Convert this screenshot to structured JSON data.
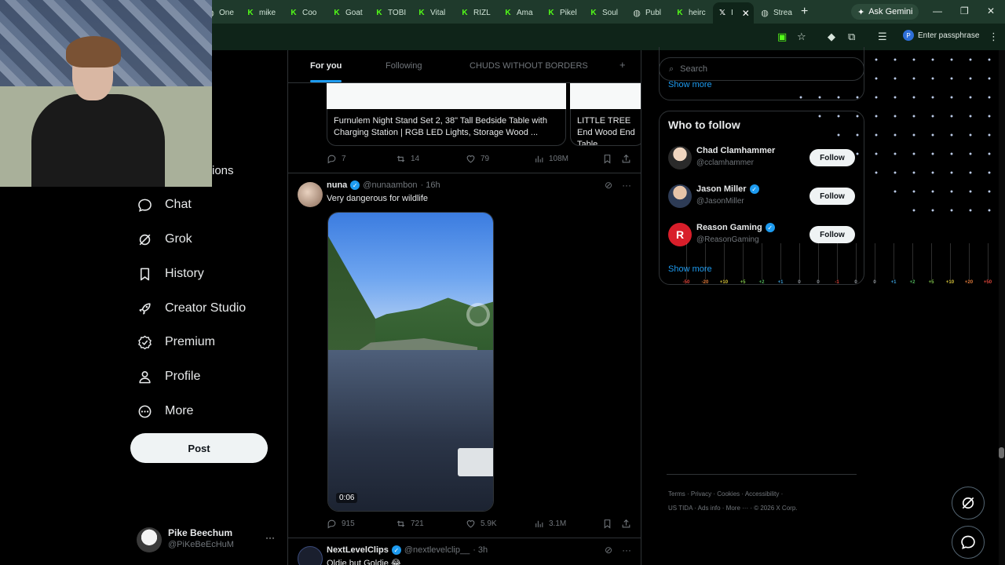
{
  "browser": {
    "tabs": [
      {
        "label": "One",
        "icon": "globe-icon",
        "active": false
      },
      {
        "label": "mike",
        "icon": "kick-icon",
        "active": false
      },
      {
        "label": "Coo",
        "icon": "kick-icon",
        "active": false
      },
      {
        "label": "Goat",
        "icon": "kick-icon",
        "active": false
      },
      {
        "label": "TOBI",
        "icon": "kick-icon",
        "active": false
      },
      {
        "label": "Vital",
        "icon": "kick-icon",
        "active": false
      },
      {
        "label": "RIZL",
        "icon": "kick-icon",
        "active": false
      },
      {
        "label": "Ama",
        "icon": "kick-icon",
        "active": false
      },
      {
        "label": "Pikel",
        "icon": "kick-icon",
        "active": false
      },
      {
        "label": "Soul",
        "icon": "kick-icon",
        "active": false
      },
      {
        "label": "Publ",
        "icon": "globe-icon",
        "active": false
      },
      {
        "label": "heirc",
        "icon": "kick-icon",
        "active": false
      },
      {
        "label": "I",
        "icon": "x-icon",
        "active": true
      },
      {
        "label": "Strea",
        "icon": "globe-icon",
        "active": false
      }
    ],
    "gemini_label": "Ask Gemini",
    "passphrase_label": "Enter passphrase",
    "passphrase_avatar": "P"
  },
  "nav": {
    "partial_label": "ions",
    "items": [
      {
        "label": "Chat",
        "icon": "chat-icon"
      },
      {
        "label": "Grok",
        "icon": "grok-icon"
      },
      {
        "label": "History",
        "icon": "bookmark-icon"
      },
      {
        "label": "Creator Studio",
        "icon": "rocket-icon"
      },
      {
        "label": "Premium",
        "icon": "verified-icon"
      },
      {
        "label": "Profile",
        "icon": "person-icon"
      },
      {
        "label": "More",
        "icon": "more-circle-icon"
      }
    ],
    "post_label": "Post",
    "account": {
      "name": "Pike Beechum",
      "handle": "@PiKeBeEcHuM",
      "more": "···"
    }
  },
  "feed": {
    "tabs": [
      "For you",
      "Following",
      "CHUDS WITHOUT BORDERS",
      "+"
    ],
    "cards": [
      {
        "caption": "Furnulem Night Stand Set 2, 38\" Tall Bedside Table with Charging Station | RGB LED Lights, Storage Wood ..."
      },
      {
        "caption": "LITTLE TREE End Wood End Table"
      }
    ],
    "card_actions": {
      "replies": "7",
      "reposts": "14",
      "likes": "79",
      "views": "108M"
    },
    "posts": [
      {
        "name": "nuna",
        "handle": "@nunaambon",
        "time": "· 16h",
        "text": "Very dangerous for wildlife",
        "video_duration": "0:06",
        "replies": "915",
        "reposts": "721",
        "likes": "5.9K",
        "views": "3.1M"
      },
      {
        "name": "NextLevelClips",
        "handle": "@nextlevelclip__",
        "time": "· 3h",
        "text": "Oldie but Goldie 😂"
      }
    ]
  },
  "sidebar": {
    "search_placeholder": "Search",
    "trends_show_more": "Show more",
    "who_to_follow": {
      "title": "Who to follow",
      "users": [
        {
          "name": "Chad Clamhammer",
          "handle": "@cclamhammer",
          "verified": false,
          "button": "Follow"
        },
        {
          "name": "Jason Miller",
          "handle": "@JasonMiller",
          "verified": true,
          "button": "Follow"
        },
        {
          "name": "Reason Gaming",
          "handle": "@ReasonGaming",
          "verified": true,
          "button": "Follow"
        }
      ],
      "show_more": "Show more"
    },
    "meter_labels": [
      "-50",
      "-20",
      "+10",
      "+5",
      "+2",
      "+1",
      "0",
      "0",
      "-1",
      "0",
      "0",
      "+1",
      "+2",
      "+5",
      "+10",
      "+20",
      "+50"
    ],
    "meter_colors": [
      "#e0453a",
      "#e07a3a",
      "#d9c53a",
      "#7fc24a",
      "#4fb35a",
      "#3a9ed9",
      "#9aa0a6",
      "#9aa0a6",
      "#e0453a",
      "#9aa0a6",
      "#9aa0a6",
      "#3a9ed9",
      "#4fb35a",
      "#7fc24a",
      "#d9c53a",
      "#e07a3a",
      "#e0453a"
    ],
    "footer": {
      "links": [
        "Terms",
        "Privacy",
        "Cookies",
        "Accessibility",
        "US TIDA",
        "Ads info",
        "More ···"
      ],
      "copyright": "© 2026 X Corp."
    }
  }
}
